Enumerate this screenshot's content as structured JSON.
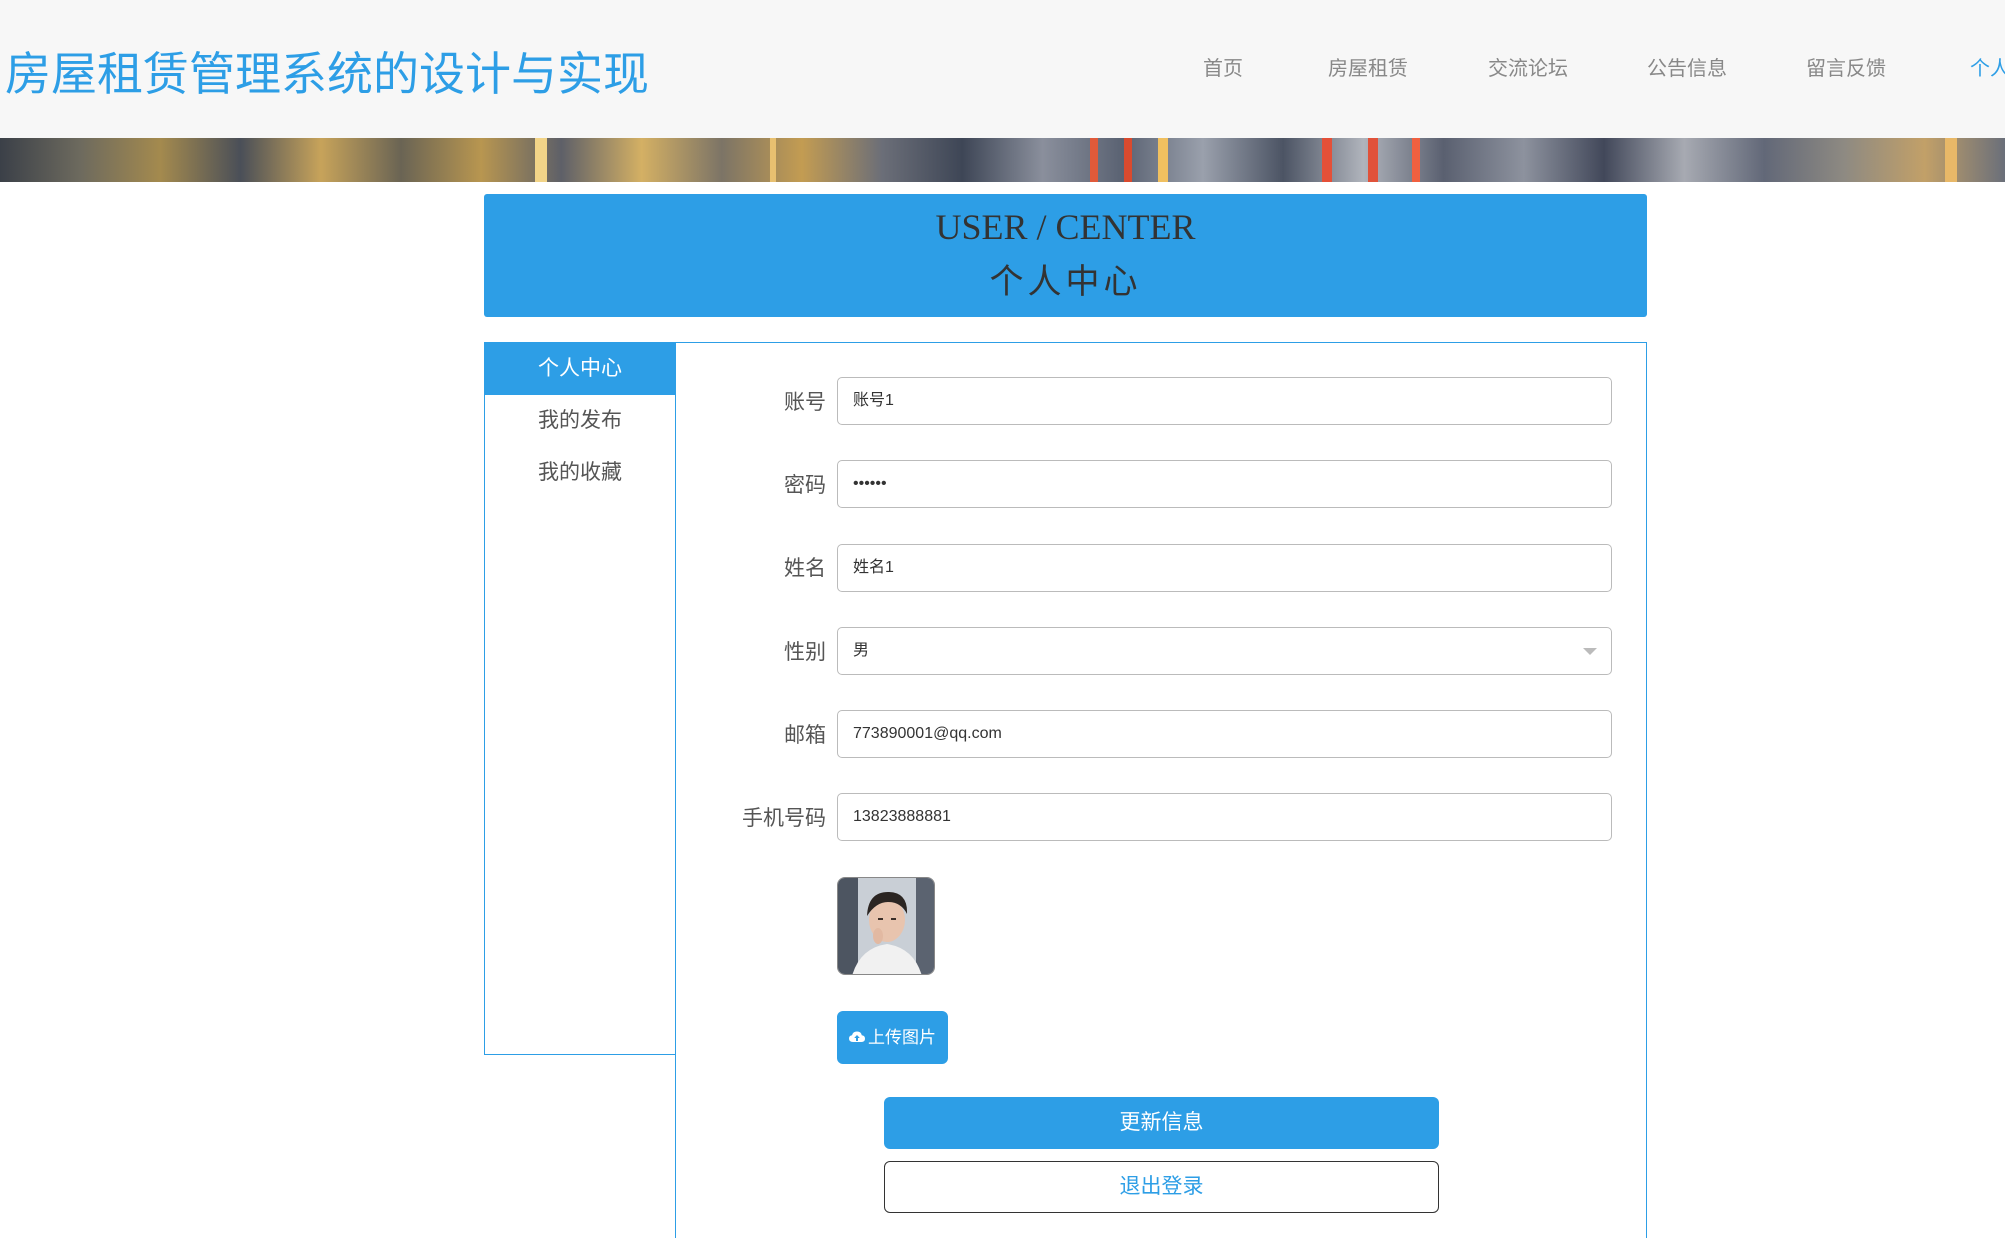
{
  "site": {
    "title": "房屋租赁管理系统的设计与实现"
  },
  "nav": {
    "items": [
      {
        "label": "首页"
      },
      {
        "label": "房屋租赁"
      },
      {
        "label": "交流论坛"
      },
      {
        "label": "公告信息"
      },
      {
        "label": "留言反馈"
      },
      {
        "label": "个人"
      }
    ],
    "active_index": 5
  },
  "page_title": {
    "en": "USER / CENTER",
    "cn": "个人中心"
  },
  "sidebar": {
    "items": [
      {
        "label": "个人中心"
      },
      {
        "label": "我的发布"
      },
      {
        "label": "我的收藏"
      }
    ],
    "active_index": 0
  },
  "form": {
    "account": {
      "label": "账号",
      "value": "账号1"
    },
    "password": {
      "label": "密码",
      "value": "••••••"
    },
    "name": {
      "label": "姓名",
      "value": "姓名1"
    },
    "gender": {
      "label": "性别",
      "value": "男"
    },
    "email": {
      "label": "邮箱",
      "value": "773890001@qq.com"
    },
    "phone": {
      "label": "手机号码",
      "value": "13823888881"
    }
  },
  "buttons": {
    "upload_label": "上传图片",
    "update_label": "更新信息",
    "logout_label": "退出登录"
  },
  "icons": {
    "upload": "cloud-upload-icon",
    "select_arrow": "caret-down-icon"
  },
  "colors": {
    "accent": "#2d9ee6",
    "header_bg": "#f7f7f7"
  }
}
